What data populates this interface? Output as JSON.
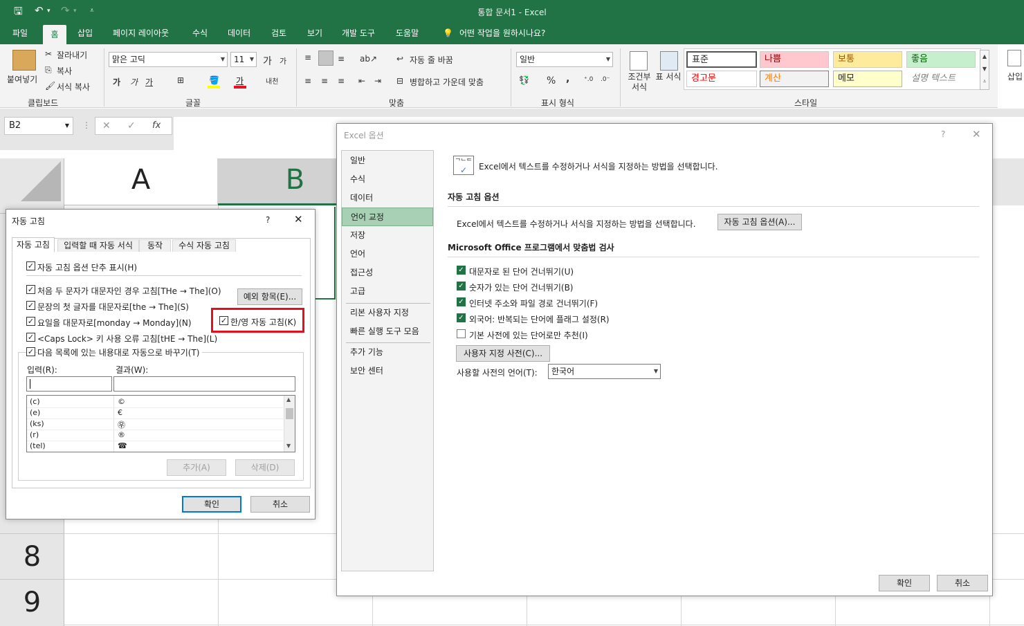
{
  "titlebar": {
    "title": "통합 문서1  -  Excel",
    "save_icon": "save-icon",
    "undo_icon": "undo-icon",
    "redo_icon": "redo-icon",
    "customize_icon": "chevron-down-icon"
  },
  "menu": {
    "tabs": [
      "파일",
      "홈",
      "삽입",
      "페이지 레이아웃",
      "수식",
      "데이터",
      "검토",
      "보기",
      "개발 도구",
      "도움말"
    ],
    "tell_me": "어떤 작업을 원하시나요?"
  },
  "ribbon": {
    "clipboard": {
      "paste": "붙여넣기",
      "cut": "잘라내기",
      "copy": "복사",
      "format_painter": "서식 복사",
      "group": "클립보드"
    },
    "font": {
      "name": "맑은 고딕",
      "size": "11",
      "grow": "가",
      "shrink": "가",
      "bold": "가",
      "italic": "가",
      "underline": "가",
      "color_a": "가",
      "phonetic": "내천",
      "group": "글꼴"
    },
    "align": {
      "wrap": "자동 줄 바꿈",
      "merge": "병합하고 가운데 맞춤",
      "group": "맞춤"
    },
    "number": {
      "format": "일반",
      "percent": "%",
      "comma": ",",
      "group": "표시 형식"
    },
    "styles_grp": {
      "conditional": "조건부 서식",
      "table": "표 서식",
      "group": "스타일",
      "cells": [
        "표준",
        "나쁨",
        "보통",
        "좋음",
        "경고문",
        "계산",
        "메모",
        "설명 텍스트"
      ]
    },
    "insert": "삽입"
  },
  "formula_bar": {
    "name_box": "B2",
    "cancel": "✕",
    "enter": "✓",
    "fx": "fx"
  },
  "sheet": {
    "columns": [
      "A",
      "B"
    ],
    "rows": [
      "8",
      "9"
    ]
  },
  "options": {
    "title": "Excel 옵션",
    "help": "?",
    "close": "✕",
    "nav": [
      "일반",
      "수식",
      "데이터",
      "언어 교정",
      "저장",
      "언어",
      "접근성",
      "고급",
      "리본 사용자 지정",
      "빠른 실행 도구 모음",
      "추가 기능",
      "보안 센터"
    ],
    "header": "Excel에서 텍스트를 수정하거나 서식을 지정하는 방법을 선택합니다.",
    "section1": "자동 고침 옵션",
    "autocorrect_desc": "Excel에서 텍스트를 수정하거나 서식을 지정하는 방법을 선택합니다.",
    "autocorrect_btn": "자동 고침 옵션(A)...",
    "section2": "Microsoft Office 프로그램에서 맞춤법 검사",
    "checks": [
      "대문자로 된 단어 건너뛰기(U)",
      "숫자가 있는 단어 건너뛰기(B)",
      "인터넷 주소와 파일 경로 건너뛰기(F)",
      "외국어: 반복되는 단어에 플래그 설정(R)",
      "기본 사전에 있는 단어로만 추천(I)"
    ],
    "custom_dict": "사용자 지정 사전(C)...",
    "dict_lang_label": "사용할 사전의 언어(T):",
    "dict_lang": "한국어",
    "ok": "확인",
    "cancel": "취소"
  },
  "autocorrect": {
    "title": "자동 고침",
    "help": "?",
    "close": "✕",
    "tabs": [
      "자동 고침",
      "입력할 때 자동 서식",
      "동작",
      "수식 자동 고침"
    ],
    "show_buttons": "자동 고침 옵션 단추 표시(H)",
    "opts": [
      "처음 두 문자가 대문자인 경우 고침[THe → The](O)",
      "문장의 첫 글자를 대문자로[the → The](S)",
      "요일을 대문자로[monday → Monday](N)",
      "<Caps Lock> 키 사용 오류 고침[tHE → The](L)",
      "다음 목록에 있는 내용대로 자동으로 바꾸기(T)"
    ],
    "exceptions": "예외 항목(E)...",
    "hanyoung": "한/영 자동 고침(K)",
    "input_label": "입력(R):",
    "result_label": "결과(W):",
    "list": [
      [
        "(c)",
        "©"
      ],
      [
        "(e)",
        "€"
      ],
      [
        "(ks)",
        "㉾"
      ],
      [
        "(r)",
        "®"
      ],
      [
        "(tel)",
        "☎"
      ]
    ],
    "add": "추가(A)",
    "delete": "삭제(D)",
    "ok": "확인",
    "cancel": "취소"
  }
}
